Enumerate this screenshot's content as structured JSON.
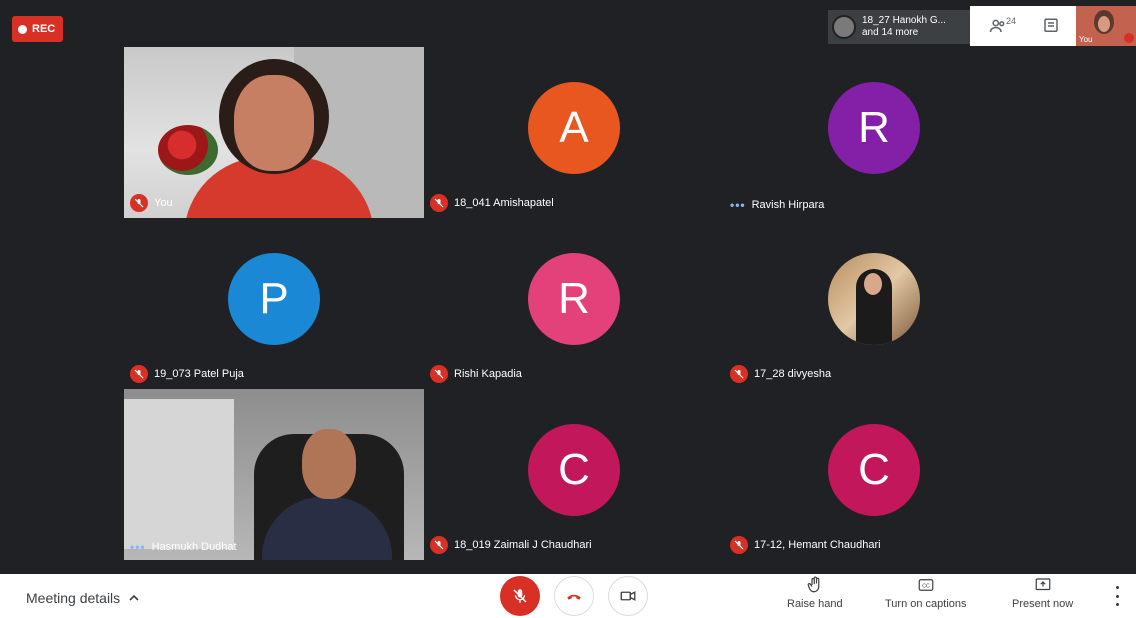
{
  "recording": {
    "label": "REC"
  },
  "participants_chip": {
    "line1": "18_27 Hanokh G...",
    "line2": "and 14 more"
  },
  "people": {
    "count": "24"
  },
  "self_view": {
    "label": "You"
  },
  "tiles": [
    {
      "name": "You",
      "status": "muted",
      "kind": "video"
    },
    {
      "name": "18_041 Amishapatel",
      "status": "muted",
      "kind": "avatar",
      "initial": "A",
      "color": "#e8571f"
    },
    {
      "name": "Ravish Hirpara",
      "status": "speaking",
      "kind": "avatar",
      "initial": "R",
      "color": "#8420a8"
    },
    {
      "name": "19_073 Patel Puja",
      "status": "muted",
      "kind": "avatar",
      "initial": "P",
      "color": "#1a88d4"
    },
    {
      "name": "Rishi Kapadia",
      "status": "muted",
      "kind": "avatar",
      "initial": "R",
      "color": "#e3417a"
    },
    {
      "name": "17_28 divyesha",
      "status": "muted",
      "kind": "photo"
    },
    {
      "name": "Hasmukh Dudhat",
      "status": "speaking",
      "kind": "video"
    },
    {
      "name": "18_019 Zaimali J Chaudhari",
      "status": "muted",
      "kind": "avatar",
      "initial": "C",
      "color": "#c2185b"
    },
    {
      "name": "17-12, Hemant Chaudhari",
      "status": "muted",
      "kind": "avatar",
      "initial": "C",
      "color": "#c2185b"
    }
  ],
  "bottom_bar": {
    "meeting_details": "Meeting details",
    "raise_hand": "Raise hand",
    "captions": "Turn on captions",
    "present": "Present now"
  },
  "colors": {
    "mute_red": "#d93025",
    "speaking_blue": "#8ab4f8",
    "background": "#202124"
  }
}
